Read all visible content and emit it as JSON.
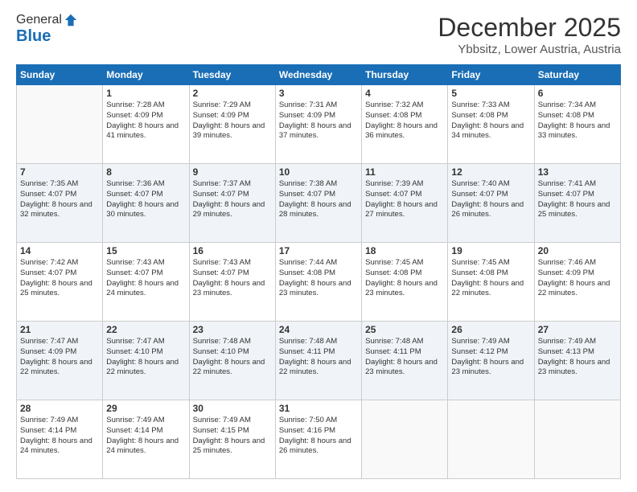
{
  "header": {
    "logo_line1": "General",
    "logo_line2": "Blue",
    "month": "December 2025",
    "location": "Ybbsitz, Lower Austria, Austria"
  },
  "weekdays": [
    "Sunday",
    "Monday",
    "Tuesday",
    "Wednesday",
    "Thursday",
    "Friday",
    "Saturday"
  ],
  "weeks": [
    [
      {
        "day": "",
        "sunrise": "",
        "sunset": "",
        "daylight": ""
      },
      {
        "day": "1",
        "sunrise": "Sunrise: 7:28 AM",
        "sunset": "Sunset: 4:09 PM",
        "daylight": "Daylight: 8 hours and 41 minutes."
      },
      {
        "day": "2",
        "sunrise": "Sunrise: 7:29 AM",
        "sunset": "Sunset: 4:09 PM",
        "daylight": "Daylight: 8 hours and 39 minutes."
      },
      {
        "day": "3",
        "sunrise": "Sunrise: 7:31 AM",
        "sunset": "Sunset: 4:09 PM",
        "daylight": "Daylight: 8 hours and 37 minutes."
      },
      {
        "day": "4",
        "sunrise": "Sunrise: 7:32 AM",
        "sunset": "Sunset: 4:08 PM",
        "daylight": "Daylight: 8 hours and 36 minutes."
      },
      {
        "day": "5",
        "sunrise": "Sunrise: 7:33 AM",
        "sunset": "Sunset: 4:08 PM",
        "daylight": "Daylight: 8 hours and 34 minutes."
      },
      {
        "day": "6",
        "sunrise": "Sunrise: 7:34 AM",
        "sunset": "Sunset: 4:08 PM",
        "daylight": "Daylight: 8 hours and 33 minutes."
      }
    ],
    [
      {
        "day": "7",
        "sunrise": "Sunrise: 7:35 AM",
        "sunset": "Sunset: 4:07 PM",
        "daylight": "Daylight: 8 hours and 32 minutes."
      },
      {
        "day": "8",
        "sunrise": "Sunrise: 7:36 AM",
        "sunset": "Sunset: 4:07 PM",
        "daylight": "Daylight: 8 hours and 30 minutes."
      },
      {
        "day": "9",
        "sunrise": "Sunrise: 7:37 AM",
        "sunset": "Sunset: 4:07 PM",
        "daylight": "Daylight: 8 hours and 29 minutes."
      },
      {
        "day": "10",
        "sunrise": "Sunrise: 7:38 AM",
        "sunset": "Sunset: 4:07 PM",
        "daylight": "Daylight: 8 hours and 28 minutes."
      },
      {
        "day": "11",
        "sunrise": "Sunrise: 7:39 AM",
        "sunset": "Sunset: 4:07 PM",
        "daylight": "Daylight: 8 hours and 27 minutes."
      },
      {
        "day": "12",
        "sunrise": "Sunrise: 7:40 AM",
        "sunset": "Sunset: 4:07 PM",
        "daylight": "Daylight: 8 hours and 26 minutes."
      },
      {
        "day": "13",
        "sunrise": "Sunrise: 7:41 AM",
        "sunset": "Sunset: 4:07 PM",
        "daylight": "Daylight: 8 hours and 25 minutes."
      }
    ],
    [
      {
        "day": "14",
        "sunrise": "Sunrise: 7:42 AM",
        "sunset": "Sunset: 4:07 PM",
        "daylight": "Daylight: 8 hours and 25 minutes."
      },
      {
        "day": "15",
        "sunrise": "Sunrise: 7:43 AM",
        "sunset": "Sunset: 4:07 PM",
        "daylight": "Daylight: 8 hours and 24 minutes."
      },
      {
        "day": "16",
        "sunrise": "Sunrise: 7:43 AM",
        "sunset": "Sunset: 4:07 PM",
        "daylight": "Daylight: 8 hours and 23 minutes."
      },
      {
        "day": "17",
        "sunrise": "Sunrise: 7:44 AM",
        "sunset": "Sunset: 4:08 PM",
        "daylight": "Daylight: 8 hours and 23 minutes."
      },
      {
        "day": "18",
        "sunrise": "Sunrise: 7:45 AM",
        "sunset": "Sunset: 4:08 PM",
        "daylight": "Daylight: 8 hours and 23 minutes."
      },
      {
        "day": "19",
        "sunrise": "Sunrise: 7:45 AM",
        "sunset": "Sunset: 4:08 PM",
        "daylight": "Daylight: 8 hours and 22 minutes."
      },
      {
        "day": "20",
        "sunrise": "Sunrise: 7:46 AM",
        "sunset": "Sunset: 4:09 PM",
        "daylight": "Daylight: 8 hours and 22 minutes."
      }
    ],
    [
      {
        "day": "21",
        "sunrise": "Sunrise: 7:47 AM",
        "sunset": "Sunset: 4:09 PM",
        "daylight": "Daylight: 8 hours and 22 minutes."
      },
      {
        "day": "22",
        "sunrise": "Sunrise: 7:47 AM",
        "sunset": "Sunset: 4:10 PM",
        "daylight": "Daylight: 8 hours and 22 minutes."
      },
      {
        "day": "23",
        "sunrise": "Sunrise: 7:48 AM",
        "sunset": "Sunset: 4:10 PM",
        "daylight": "Daylight: 8 hours and 22 minutes."
      },
      {
        "day": "24",
        "sunrise": "Sunrise: 7:48 AM",
        "sunset": "Sunset: 4:11 PM",
        "daylight": "Daylight: 8 hours and 22 minutes."
      },
      {
        "day": "25",
        "sunrise": "Sunrise: 7:48 AM",
        "sunset": "Sunset: 4:11 PM",
        "daylight": "Daylight: 8 hours and 23 minutes."
      },
      {
        "day": "26",
        "sunrise": "Sunrise: 7:49 AM",
        "sunset": "Sunset: 4:12 PM",
        "daylight": "Daylight: 8 hours and 23 minutes."
      },
      {
        "day": "27",
        "sunrise": "Sunrise: 7:49 AM",
        "sunset": "Sunset: 4:13 PM",
        "daylight": "Daylight: 8 hours and 23 minutes."
      }
    ],
    [
      {
        "day": "28",
        "sunrise": "Sunrise: 7:49 AM",
        "sunset": "Sunset: 4:14 PM",
        "daylight": "Daylight: 8 hours and 24 minutes."
      },
      {
        "day": "29",
        "sunrise": "Sunrise: 7:49 AM",
        "sunset": "Sunset: 4:14 PM",
        "daylight": "Daylight: 8 hours and 24 minutes."
      },
      {
        "day": "30",
        "sunrise": "Sunrise: 7:49 AM",
        "sunset": "Sunset: 4:15 PM",
        "daylight": "Daylight: 8 hours and 25 minutes."
      },
      {
        "day": "31",
        "sunrise": "Sunrise: 7:50 AM",
        "sunset": "Sunset: 4:16 PM",
        "daylight": "Daylight: 8 hours and 26 minutes."
      },
      {
        "day": "",
        "sunrise": "",
        "sunset": "",
        "daylight": ""
      },
      {
        "day": "",
        "sunrise": "",
        "sunset": "",
        "daylight": ""
      },
      {
        "day": "",
        "sunrise": "",
        "sunset": "",
        "daylight": ""
      }
    ]
  ]
}
